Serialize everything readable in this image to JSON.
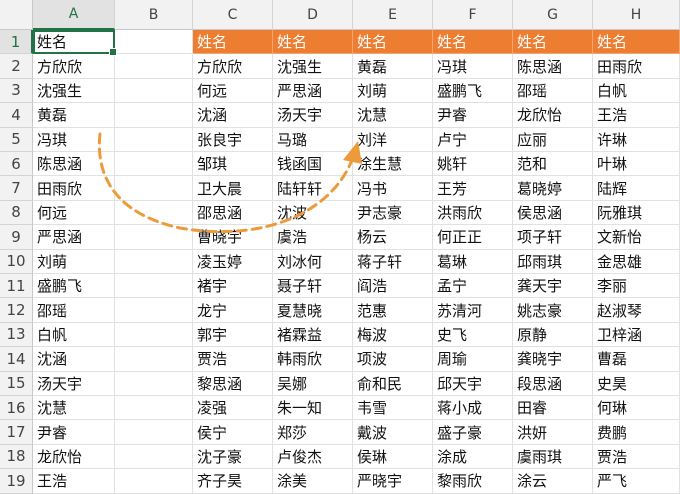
{
  "columns": [
    "A",
    "B",
    "C",
    "D",
    "E",
    "F",
    "G",
    "H"
  ],
  "selected_column": "A",
  "selected_row": 1,
  "rows": [
    {
      "num": "1",
      "A": "姓名",
      "C": "姓名",
      "D": "姓名",
      "E": "姓名",
      "F": "姓名",
      "G": "姓名",
      "H": "姓名"
    },
    {
      "num": "2",
      "A": "方欣欣",
      "C": "方欣欣",
      "D": "沈强生",
      "E": "黄磊",
      "F": "冯琪",
      "G": "陈思涵",
      "H": "田雨欣"
    },
    {
      "num": "3",
      "A": "沈强生",
      "C": "何远",
      "D": "严思涵",
      "E": "刘萌",
      "F": "盛鹏飞",
      "G": "邵瑶",
      "H": "白帆"
    },
    {
      "num": "4",
      "A": "黄磊",
      "C": "沈涵",
      "D": "汤天宇",
      "E": "沈慧",
      "F": "尹睿",
      "G": "龙欣怡",
      "H": "王浩"
    },
    {
      "num": "5",
      "A": "冯琪",
      "C": "张良宇",
      "D": "马璐",
      "E": "刘洋",
      "F": "卢宁",
      "G": "应丽",
      "H": "许琳"
    },
    {
      "num": "6",
      "A": "陈思涵",
      "C": "邹琪",
      "D": "钱函国",
      "E": "涂生慧",
      "F": "姚轩",
      "G": "范和",
      "H": "叶琳"
    },
    {
      "num": "7",
      "A": "田雨欣",
      "C": "卫大晨",
      "D": "陆轩轩",
      "E": "冯书",
      "F": "王芳",
      "G": "葛晓婷",
      "H": "陆辉"
    },
    {
      "num": "8",
      "A": "何远",
      "C": "邵思涵",
      "D": "沈波",
      "E": "尹志豪",
      "F": "洪雨欣",
      "G": "侯思涵",
      "H": "阮雅琪"
    },
    {
      "num": "9",
      "A": "严思涵",
      "C": "曹晓宇",
      "D": "虞浩",
      "E": "杨云",
      "F": "何正正",
      "G": "项子轩",
      "H": "文新怡"
    },
    {
      "num": "10",
      "A": "刘萌",
      "C": "凌玉婷",
      "D": "刘冰何",
      "E": "蒋子轩",
      "F": "葛琳",
      "G": "邱雨琪",
      "H": "金思雄"
    },
    {
      "num": "11",
      "A": "盛鹏飞",
      "C": "褚宇",
      "D": "聂子轩",
      "E": "阎浩",
      "F": "孟宁",
      "G": "龚天宇",
      "H": "李丽"
    },
    {
      "num": "12",
      "A": "邵瑶",
      "C": "龙宁",
      "D": "夏慧晓",
      "E": "范惠",
      "F": "苏清河",
      "G": "姚志豪",
      "H": "赵淑琴"
    },
    {
      "num": "13",
      "A": "白帆",
      "C": "郭宇",
      "D": "褚霖益",
      "E": "梅波",
      "F": "史飞",
      "G": "原静",
      "H": "卫梓涵"
    },
    {
      "num": "14",
      "A": "沈涵",
      "C": "贾浩",
      "D": "韩雨欣",
      "E": "项波",
      "F": "周瑜",
      "G": "龚晓宇",
      "H": "曹磊"
    },
    {
      "num": "15",
      "A": "汤天宇",
      "C": "黎思涵",
      "D": "吴娜",
      "E": "俞和民",
      "F": "邱天宇",
      "G": "段思涵",
      "H": "史昊"
    },
    {
      "num": "16",
      "A": "沈慧",
      "C": "凌强",
      "D": "朱一知",
      "E": "韦雪",
      "F": "蒋小成",
      "G": "田睿",
      "H": "何琳"
    },
    {
      "num": "17",
      "A": "尹睿",
      "C": "侯宁",
      "D": "郑莎",
      "E": "戴波",
      "F": "盛子豪",
      "G": "洪妍",
      "H": "费鹏"
    },
    {
      "num": "18",
      "A": "龙欣怡",
      "C": "沈子豪",
      "D": "卢俊杰",
      "E": "侯琳",
      "F": "涂成",
      "G": "虞雨琪",
      "H": "贾浩"
    },
    {
      "num": "19",
      "A": "王浩",
      "C": "齐子昊",
      "D": "涂美",
      "E": "严晓宇",
      "F": "黎雨欣",
      "G": "涂云",
      "H": "严飞"
    }
  ],
  "colors": {
    "header_fill": "#ed7d31",
    "selection": "#217346",
    "arrow": "#ed9a3a"
  }
}
